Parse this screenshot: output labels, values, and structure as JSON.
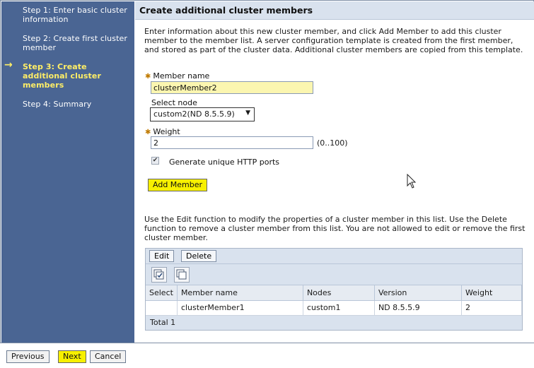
{
  "sidebar": {
    "steps": [
      {
        "label": "Step 1: Enter basic cluster information",
        "current": false
      },
      {
        "label": "Step 2: Create first cluster member",
        "current": false
      },
      {
        "label": "Step 3: Create additional cluster members",
        "current": true
      },
      {
        "label": "Step 4: Summary",
        "current": false
      }
    ],
    "current_arrow": "→"
  },
  "main": {
    "title": "Create additional cluster members",
    "intro": "Enter information about this new cluster member, and click Add Member to add this cluster member to the member list. A server configuration template is created from the first member, and stored as part of the cluster data. Additional cluster members are copied from this template.",
    "member_name_label": "Member name",
    "member_name_value": "clusterMember2",
    "select_node_label": "Select node",
    "select_node_value": "custom2(ND 8.5.5.9)",
    "weight_label": "Weight",
    "weight_value": "2",
    "weight_range": "(0..100)",
    "unique_ports_label": "Generate unique HTTP ports",
    "unique_ports_checked": true,
    "add_member_label": "Add Member",
    "list_help": "Use the Edit function to modify the properties of a cluster member in this list. Use the Delete function to remove a cluster member from this list. You are not allowed to edit or remove the first cluster member."
  },
  "table": {
    "edit_label": "Edit",
    "delete_label": "Delete",
    "columns": [
      "Select",
      "Member name",
      "Nodes",
      "Version",
      "Weight"
    ],
    "rows": [
      {
        "select": "",
        "member_name": "clusterMember1",
        "nodes": "custom1",
        "version": "ND 8.5.5.9",
        "weight": "2"
      }
    ],
    "total": "Total 1"
  },
  "footer": {
    "previous_label": "Previous",
    "next_label": "Next",
    "cancel_label": "Cancel"
  },
  "colors": {
    "sidebar_bg": "#4a6593",
    "current_step": "#ffee66",
    "highlight_button": "#f7f000",
    "header_bg": "#d9e2ee"
  }
}
